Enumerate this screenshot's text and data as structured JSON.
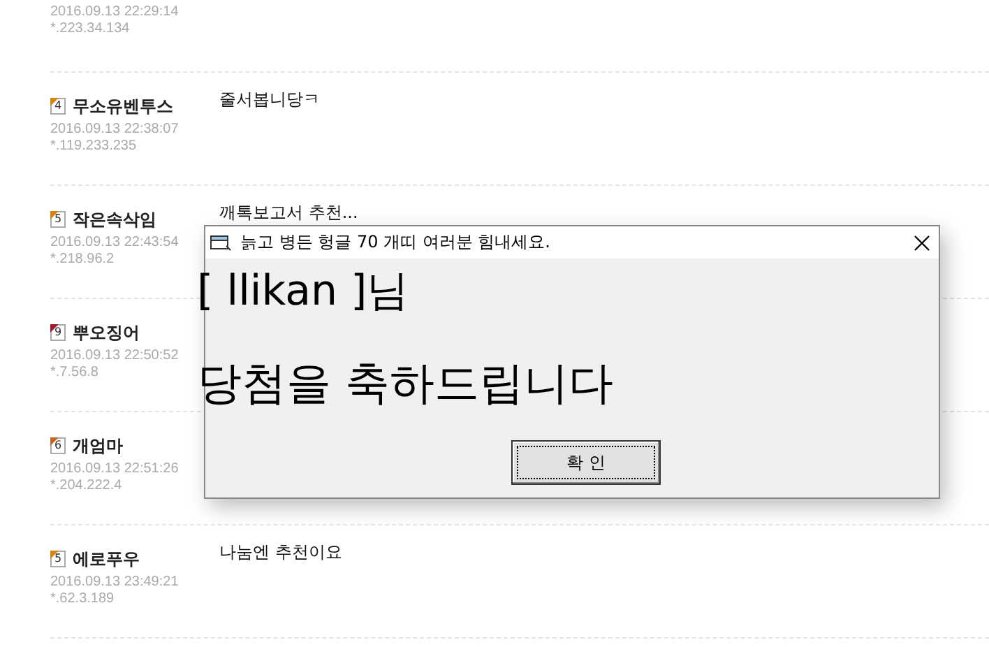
{
  "comments": [
    {
      "date": "2016.09.13 22:29:14",
      "ip": "*.223.34.134"
    },
    {
      "level": "4",
      "color": "#d9820f",
      "name": "무소유벤투스",
      "date": "2016.09.13 22:38:07",
      "ip": "*.119.233.235",
      "text": "줄서봅니당ㅋ"
    },
    {
      "level": "5",
      "color": "#d9820f",
      "name": "작은속삭임",
      "date": "2016.09.13 22:43:54",
      "ip": "*.218.96.2",
      "text": "깨톡보고서 추천..."
    },
    {
      "level": "9",
      "color": "#a01c2c",
      "name": "뿌오징어",
      "date": "2016.09.13 22:50:52",
      "ip": "*.7.56.8"
    },
    {
      "level": "6",
      "color": "#c8641e",
      "name": "개엄마",
      "date": "2016.09.13 22:51:26",
      "ip": "*.204.222.4"
    },
    {
      "level": "5",
      "color": "#d9820f",
      "name": "에로푸우",
      "date": "2016.09.13 23:49:21",
      "ip": "*.62.3.189",
      "text": "나눔엔 추천이요"
    }
  ],
  "dialog": {
    "title": "늙고 병든 헝글 70 개띠 여러분 힘내세요.",
    "lines": [
      "[ llikan ]님",
      "당첨을 축하드립니다"
    ],
    "button": "확 인"
  }
}
